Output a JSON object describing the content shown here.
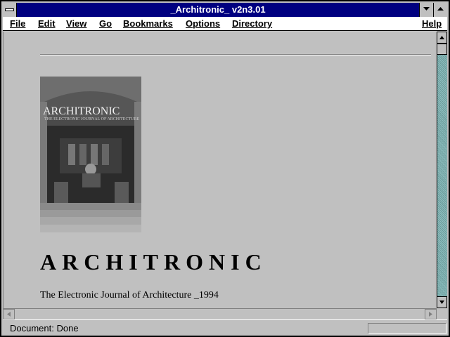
{
  "window": {
    "title": "_Architronic_ v2n3.01"
  },
  "menu": {
    "file": "F",
    "file_rest": "ile",
    "edit": "E",
    "edit_rest": "dit",
    "view": "V",
    "view_rest": "iew",
    "go": "G",
    "go_rest": "o",
    "bookmarks": "B",
    "bookmarks_rest": "ookmarks",
    "options": "O",
    "options_rest": "ptions",
    "directory": "D",
    "directory_rest": "irectory",
    "help": "H",
    "help_rest": "elp"
  },
  "page": {
    "cover_title": "ARCHITRONIC",
    "cover_subtitle": "THE ELECTRONIC JOURNAL OF ARCHITECTURE",
    "heading": "ARCHITRONIC",
    "subheading": "The Electronic Journal of Architecture _1994"
  },
  "status": {
    "text": "Document: Done",
    "progress": 0
  },
  "icons": {
    "system_menu": "system-menu-icon",
    "minimize": "triangle-down-icon",
    "maximize": "triangle-up-icon",
    "scroll_up": "arrow-up-icon",
    "scroll_down": "arrow-down-icon",
    "scroll_left": "arrow-left-icon",
    "scroll_right": "arrow-right-icon"
  },
  "colors": {
    "titlebar": "#000080",
    "background": "#c0c0c0",
    "scrollbar_track": "#7aa9a9"
  }
}
